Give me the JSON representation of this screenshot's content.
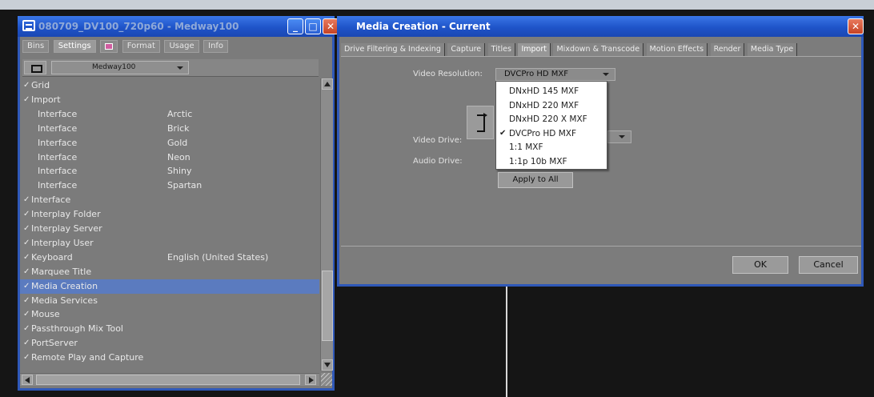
{
  "project_window": {
    "title": "080709_DV100_720p60 - Medway100",
    "tabs": [
      "Bins",
      "Settings",
      "Format",
      "Usage",
      "Info"
    ],
    "toolbar_select": "Medway100",
    "items": [
      {
        "check": "✓",
        "label": "Grid",
        "value": "",
        "indent": false
      },
      {
        "check": "✓",
        "label": "Import",
        "value": "",
        "indent": false
      },
      {
        "check": "",
        "label": "Interface",
        "value": "Arctic",
        "indent": true
      },
      {
        "check": "",
        "label": "Interface",
        "value": "Brick",
        "indent": true
      },
      {
        "check": "",
        "label": "Interface",
        "value": "Gold",
        "indent": true
      },
      {
        "check": "",
        "label": "Interface",
        "value": "Neon",
        "indent": true
      },
      {
        "check": "",
        "label": "Interface",
        "value": "Shiny",
        "indent": true
      },
      {
        "check": "",
        "label": "Interface",
        "value": "Spartan",
        "indent": true
      },
      {
        "check": "✓",
        "label": "Interface",
        "value": "",
        "indent": false
      },
      {
        "check": "✓",
        "label": "Interplay Folder",
        "value": "",
        "indent": false
      },
      {
        "check": "✓",
        "label": "Interplay Server",
        "value": "",
        "indent": false
      },
      {
        "check": "✓",
        "label": "Interplay User",
        "value": "",
        "indent": false
      },
      {
        "check": "✓",
        "label": "Keyboard",
        "value": "English (United States)",
        "indent": false
      },
      {
        "check": "✓",
        "label": "Marquee Title",
        "value": "",
        "indent": false
      },
      {
        "check": "✓",
        "label": "Media Creation",
        "value": "",
        "indent": false,
        "selected": true
      },
      {
        "check": "✓",
        "label": "Media Services",
        "value": "",
        "indent": false
      },
      {
        "check": "✓",
        "label": "Mouse",
        "value": "",
        "indent": false
      },
      {
        "check": "✓",
        "label": "Passthrough Mix Tool",
        "value": "",
        "indent": false
      },
      {
        "check": "✓",
        "label": "PortServer",
        "value": "",
        "indent": false
      },
      {
        "check": "✓",
        "label": "Remote Play and Capture",
        "value": "",
        "indent": false
      }
    ]
  },
  "media_dialog": {
    "title": "Media Creation - Current",
    "tabs": [
      "Drive Filtering & Indexing",
      "Capture",
      "Titles",
      "Import",
      "Mixdown & Transcode",
      "Motion Effects",
      "Render",
      "Media Type"
    ],
    "active_tab": "Import",
    "video_resolution_label": "Video Resolution:",
    "video_resolution_value": "DVCPro HD MXF",
    "video_drive_label": "Video Drive:",
    "audio_drive_label": "Audio Drive:",
    "apply_to_all": "Apply to All",
    "ok": "OK",
    "cancel": "Cancel",
    "resolution_options": [
      {
        "label": "DNxHD 145 MXF",
        "checked": false
      },
      {
        "label": "DNxHD 220 MXF",
        "checked": false
      },
      {
        "label": "DNxHD 220 X MXF",
        "checked": false
      },
      {
        "label": "DVCPro HD MXF",
        "checked": true
      },
      {
        "label": "1:1 MXF",
        "checked": false
      },
      {
        "label": "1:1p 10b MXF",
        "checked": false
      }
    ]
  },
  "colors": {
    "title_bar": "#1f54c9",
    "panel": "#7b7b7b",
    "selection": "#5b7bbf",
    "close_button": "#c64324"
  }
}
